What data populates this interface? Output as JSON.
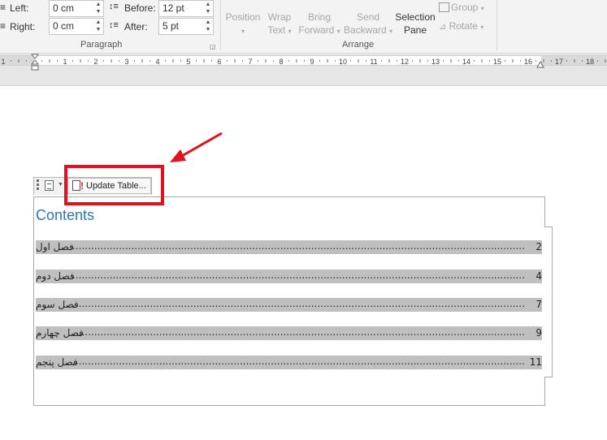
{
  "ribbon": {
    "paragraph": {
      "left_label": "Left:",
      "left_value": "0 cm",
      "right_label": "Right:",
      "right_value": "0 cm",
      "before_label": "Before:",
      "before_value": "12 pt",
      "after_label": "After:",
      "after_value": "5 pt",
      "group_label": "Paragraph"
    },
    "arrange": {
      "position_label": "Position",
      "wrap_text_1": "Wrap",
      "wrap_text_2": "Text",
      "bring_forward_1": "Bring",
      "bring_forward_2": "Forward",
      "send_backward_1": "Send",
      "send_backward_2": "Backward",
      "selection_pane_1": "Selection",
      "selection_pane_2": "Pane",
      "group_btn": "Group",
      "rotate_btn": "Rotate",
      "group_label": "Arrange"
    }
  },
  "ruler": {
    "numbers": [
      "1",
      "1",
      "2",
      "3",
      "4",
      "5",
      "6",
      "7",
      "8",
      "9",
      "10",
      "11",
      "12",
      "13",
      "14",
      "15",
      "16",
      "17",
      "18"
    ]
  },
  "toc": {
    "update_button": "Update Table...",
    "title": "Contents",
    "entries": [
      {
        "label": "فصل اول",
        "page": "2"
      },
      {
        "label": "فصل دوم",
        "page": "4"
      },
      {
        "label": "فصل سوم",
        "page": "7"
      },
      {
        "label": "فصل چهارم",
        "page": "9"
      },
      {
        "label": "فصل پنجم",
        "page": "11"
      }
    ]
  },
  "colors": {
    "annotation": "#e1121c",
    "heading": "#2e74b5",
    "entry_highlight": "#bfbfbf"
  }
}
